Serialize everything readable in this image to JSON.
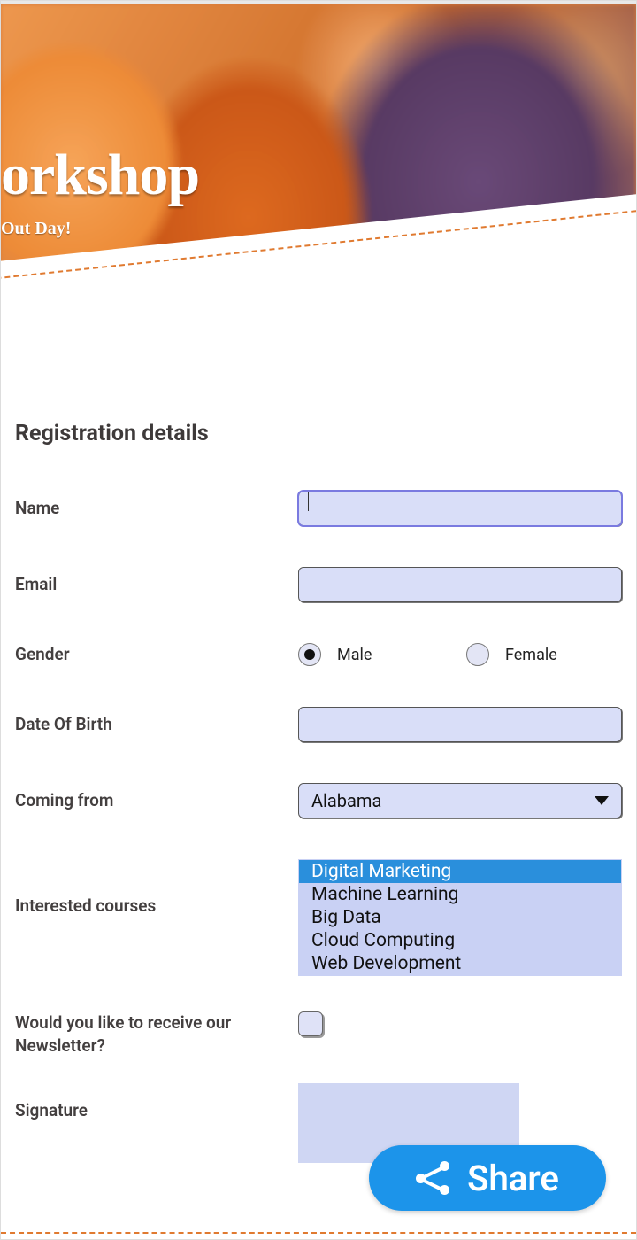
{
  "hero": {
    "title_partial": "orkshop",
    "subtitle_partial": "Out Day!"
  },
  "form": {
    "section_title": "Registration details",
    "name": {
      "label": "Name",
      "value": ""
    },
    "email": {
      "label": "Email",
      "value": ""
    },
    "gender": {
      "label": "Gender",
      "options": [
        "Male",
        "Female"
      ],
      "selected": "Male"
    },
    "dob": {
      "label": "Date Of Birth",
      "value": ""
    },
    "coming_from": {
      "label": "Coming from",
      "selected": "Alabama"
    },
    "courses": {
      "label": "Interested courses",
      "options": [
        "Digital Marketing",
        "Machine Learning",
        "Big Data",
        "Cloud Computing",
        "Web Development"
      ],
      "selected": [
        "Digital Marketing"
      ]
    },
    "newsletter": {
      "label": "Would you like to receive our Newsletter?",
      "checked": false
    },
    "signature": {
      "label": "Signature"
    }
  },
  "share": {
    "label": "Share"
  }
}
